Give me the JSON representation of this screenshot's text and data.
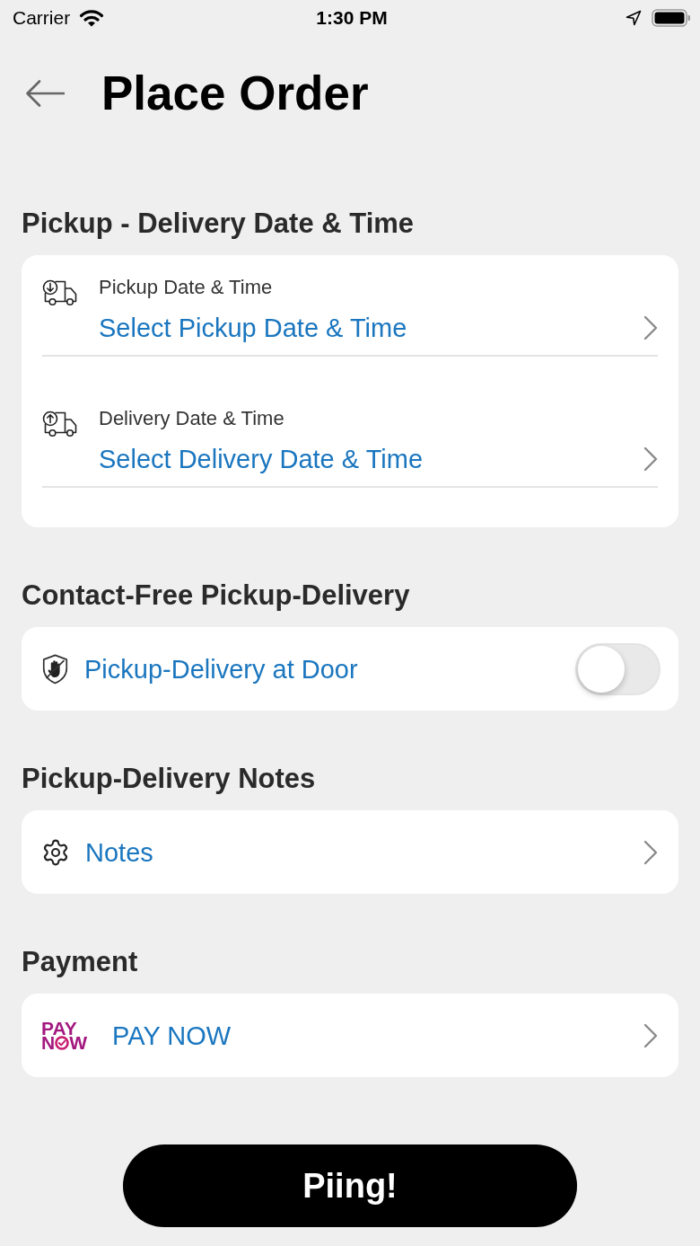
{
  "status_bar": {
    "carrier": "Carrier",
    "time": "1:30 PM"
  },
  "header": {
    "title": "Place Order"
  },
  "schedule": {
    "heading": "Pickup - Delivery Date & Time",
    "rows": [
      {
        "kind": "pickup",
        "label": "Pickup Date & Time",
        "value": "Select Pickup Date & Time"
      },
      {
        "kind": "delivery",
        "label": "Delivery Date & Time",
        "value": "Select Delivery Date & Time"
      }
    ]
  },
  "contact_free": {
    "heading": "Contact-Free Pickup-Delivery",
    "label": "Pickup-Delivery at Door",
    "on": false
  },
  "notes": {
    "heading": "Pickup-Delivery Notes",
    "label": "Notes"
  },
  "payment": {
    "heading": "Payment",
    "logo": {
      "top": "PAY",
      "bottom_left": "N",
      "bottom_right": "W"
    },
    "label": "PAY NOW"
  },
  "submit_button": {
    "label": "Piing!"
  }
}
